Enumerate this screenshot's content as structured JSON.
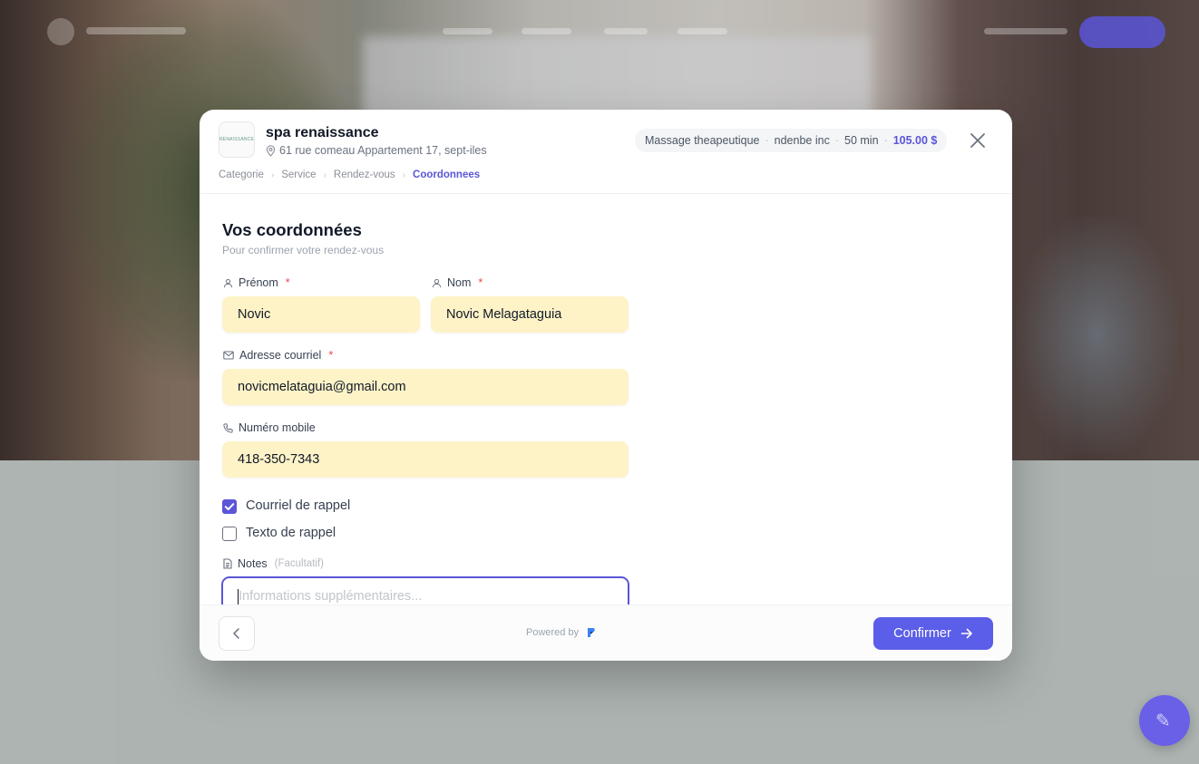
{
  "spa": {
    "name": "spa renaissance",
    "address": "61 rue comeau Appartement 17, sept-iles",
    "logo_text": "RENAISSANCE"
  },
  "summary": {
    "service": "Massage theapeutique",
    "provider": "ndenbe inc",
    "duration": "50 min",
    "price": "105.00 $"
  },
  "breadcrumb": [
    "Categorie",
    "Service",
    "Rendez-vous",
    "Coordonnees"
  ],
  "form": {
    "title": "Vos coordonnées",
    "subtitle": "Pour confirmer votre rendez-vous",
    "required_mark": "*",
    "first_name": {
      "label": "Prénom",
      "value": "Novic"
    },
    "last_name": {
      "label": "Nom",
      "value": "Novic Melagataguia"
    },
    "email": {
      "label": "Adresse courriel",
      "value": "novicmelataguia@gmail.com"
    },
    "phone": {
      "label": "Numéro mobile",
      "value": "418-350-7343"
    },
    "email_reminder": {
      "label": "Courriel de rappel",
      "checked": true
    },
    "sms_reminder": {
      "label": "Texto de rappel",
      "checked": false
    },
    "notes": {
      "label": "Notes",
      "optional": "(Facultatif)",
      "placeholder": "Informations supplémentaires..."
    }
  },
  "footer": {
    "powered_by": "Powered by",
    "confirm_label": "Confirmer"
  },
  "colors": {
    "accent": "#5b55d8",
    "field_fill": "#fef3c7",
    "required": "#ef4444"
  }
}
